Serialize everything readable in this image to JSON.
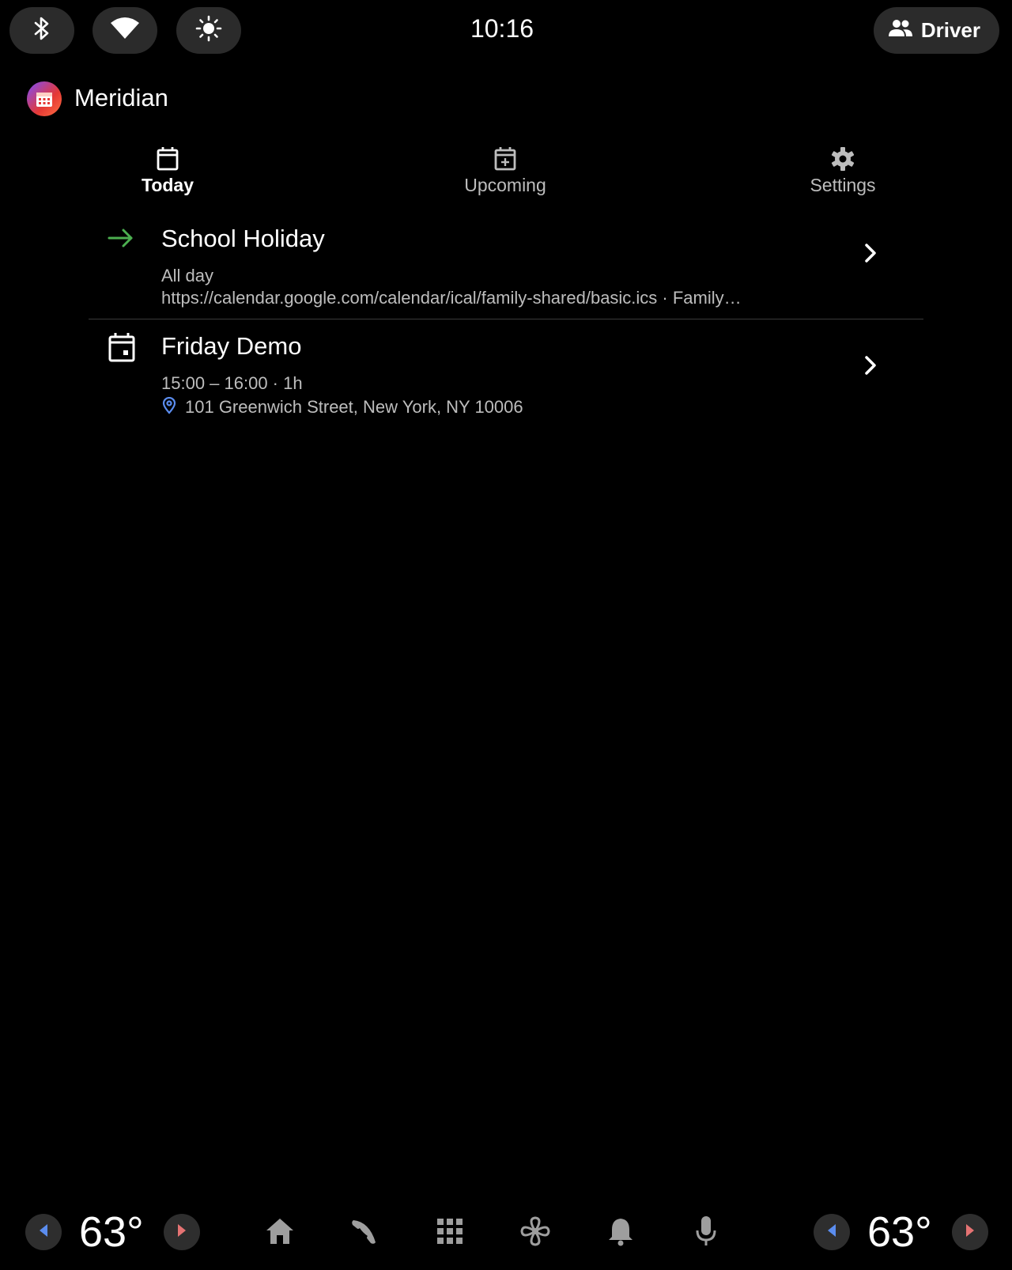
{
  "status_bar": {
    "time": "10:16",
    "profile_label": "Driver",
    "icons": [
      "bluetooth-icon",
      "wifi-icon",
      "brightness-icon",
      "people-icon"
    ]
  },
  "app": {
    "title": "Meridian",
    "icon": "calendar-app-icon"
  },
  "tabs": [
    {
      "label": "Today",
      "icon": "calendar-icon",
      "active": true
    },
    {
      "label": "Upcoming",
      "icon": "calendar-add-icon",
      "active": false
    },
    {
      "label": "Settings",
      "icon": "gear-icon",
      "active": false
    }
  ],
  "events": [
    {
      "title": "School Holiday",
      "when": "All day",
      "source": "https://calendar.google.com/calendar/ical/family-shared/basic.ics · Family…",
      "icon": "arrow-right-icon",
      "icon_color": "#4caf50"
    },
    {
      "title": "Friday Demo",
      "when": "15:00 – 16:00 · 1h",
      "location": "101 Greenwich Street, New York, NY 10006",
      "icon": "calendar-event-icon",
      "location_icon_color": "#5b8def"
    }
  ],
  "bottom_bar": {
    "left_temp": "63°",
    "right_temp": "63°",
    "dock_icons": [
      "home-icon",
      "phone-icon",
      "apps-grid-icon",
      "fan-icon",
      "bell-icon",
      "microphone-icon"
    ],
    "colors": {
      "decrease_arrow": "#5b8def",
      "increase_arrow": "#e57373",
      "dock_icon": "#9e9e9e"
    }
  }
}
